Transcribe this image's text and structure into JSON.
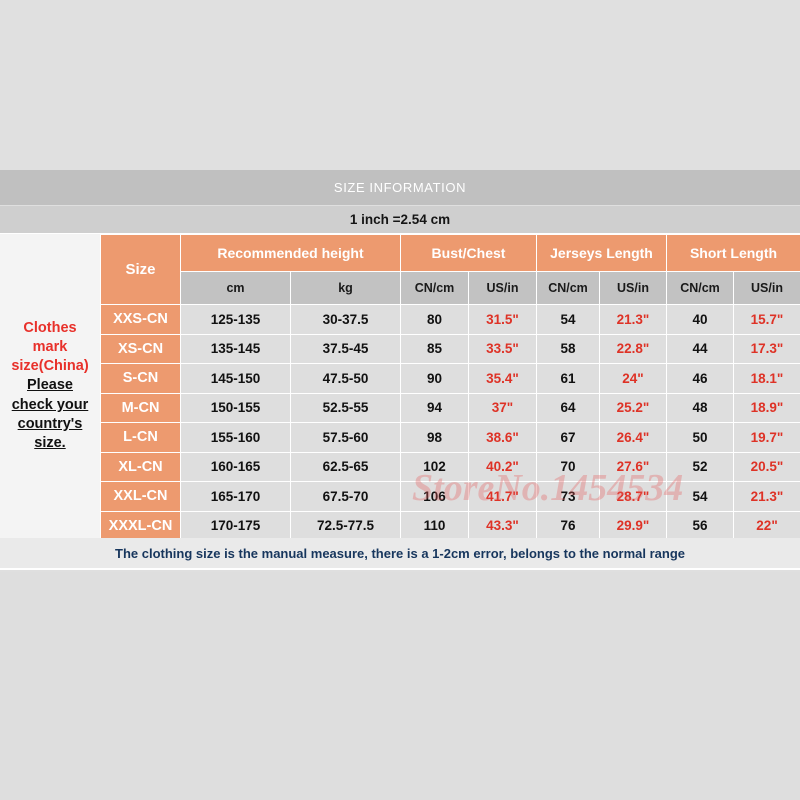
{
  "banner": {
    "title": "SIZE INFORMATION"
  },
  "conversion": {
    "note": "1 inch =2.54 cm"
  },
  "notice": {
    "red_line1": "Clothes",
    "red_line2": "mark",
    "red_line3": "size(China)",
    "black_line1": "Please",
    "black_line2": "check your",
    "black_line3": "country's",
    "black_line4": "size."
  },
  "watermark": {
    "text": "StoreNo.1454534"
  },
  "footer": {
    "note": "The clothing size is the manual measure, there is a 1-2cm error, belongs to the normal range"
  },
  "colors": {
    "orange": "#ed9a6f",
    "header_gray": "#c2c2c2",
    "cell_gray": "#dedede",
    "banner_gray": "#c0c0c0",
    "red_text": "#de3226",
    "notice_red": "#e8302a",
    "footer_blue": "#17365d"
  },
  "table": {
    "group_headers": {
      "size": "Size",
      "recommended_height": "Recommended height",
      "bust_chest": "Bust/Chest",
      "jerseys_length": "Jerseys Length",
      "short_length": "Short Length"
    },
    "sub_headers": {
      "cm": "cm",
      "kg": "kg",
      "bust_cn": "CN/cm",
      "bust_us": "US/in",
      "jersey_cn": "CN/cm",
      "jersey_us": "US/in",
      "short_cn": "CN/cm",
      "short_us": "US/in"
    },
    "rows": [
      {
        "size": "XXS-CN",
        "height_cm": "125-135",
        "weight_kg": "30-37.5",
        "bust_cn": "80",
        "bust_us": "31.5\"",
        "jersey_cn": "54",
        "jersey_us": "21.3\"",
        "short_cn": "40",
        "short_us": "15.7\""
      },
      {
        "size": "XS-CN",
        "height_cm": "135-145",
        "weight_kg": "37.5-45",
        "bust_cn": "85",
        "bust_us": "33.5\"",
        "jersey_cn": "58",
        "jersey_us": "22.8\"",
        "short_cn": "44",
        "short_us": "17.3\""
      },
      {
        "size": "S-CN",
        "height_cm": "145-150",
        "weight_kg": "47.5-50",
        "bust_cn": "90",
        "bust_us": "35.4\"",
        "jersey_cn": "61",
        "jersey_us": "24\"",
        "short_cn": "46",
        "short_us": "18.1\""
      },
      {
        "size": "M-CN",
        "height_cm": "150-155",
        "weight_kg": "52.5-55",
        "bust_cn": "94",
        "bust_us": "37\"",
        "jersey_cn": "64",
        "jersey_us": "25.2\"",
        "short_cn": "48",
        "short_us": "18.9\""
      },
      {
        "size": "L-CN",
        "height_cm": "155-160",
        "weight_kg": "57.5-60",
        "bust_cn": "98",
        "bust_us": "38.6\"",
        "jersey_cn": "67",
        "jersey_us": "26.4\"",
        "short_cn": "50",
        "short_us": "19.7\""
      },
      {
        "size": "XL-CN",
        "height_cm": "160-165",
        "weight_kg": "62.5-65",
        "bust_cn": "102",
        "bust_us": "40.2\"",
        "jersey_cn": "70",
        "jersey_us": "27.6\"",
        "short_cn": "52",
        "short_us": "20.5\""
      },
      {
        "size": "XXL-CN",
        "height_cm": "165-170",
        "weight_kg": "67.5-70",
        "bust_cn": "106",
        "bust_us": "41.7\"",
        "jersey_cn": "73",
        "jersey_us": "28.7\"",
        "short_cn": "54",
        "short_us": "21.3\""
      },
      {
        "size": "XXXL-CN",
        "height_cm": "170-175",
        "weight_kg": "72.5-77.5",
        "bust_cn": "110",
        "bust_us": "43.3\"",
        "jersey_cn": "76",
        "jersey_us": "29.9\"",
        "short_cn": "56",
        "short_us": "22\""
      }
    ]
  }
}
